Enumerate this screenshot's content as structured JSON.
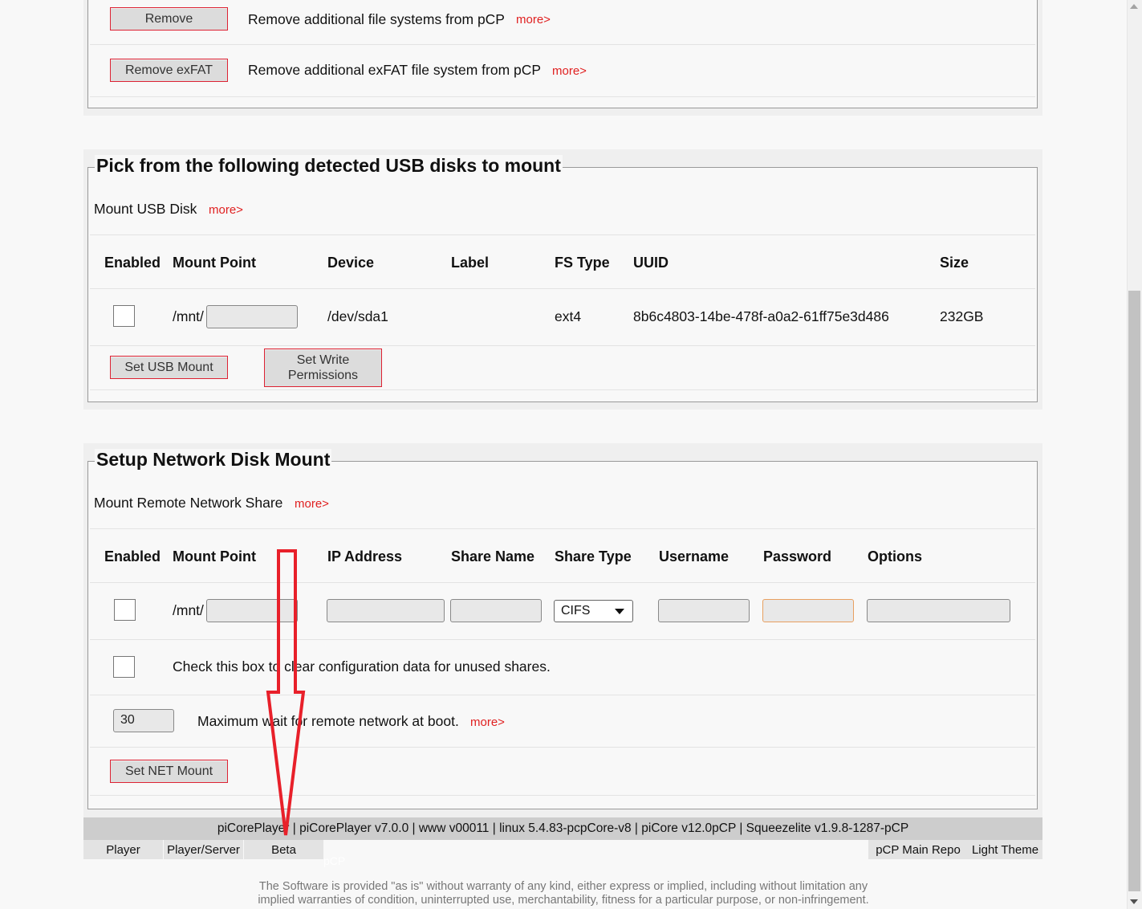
{
  "remove_section": {
    "rows": [
      {
        "button": "Remove",
        "text": "Remove additional file systems from pCP",
        "more": "more>"
      },
      {
        "button": "Remove exFAT",
        "text": "Remove additional exFAT file system from pCP",
        "more": "more>"
      }
    ]
  },
  "usb_section": {
    "legend": "Pick from the following detected USB disks to mount",
    "subtitle": "Mount USB Disk",
    "more": "more>",
    "headers": [
      "Enabled",
      "Mount Point",
      "Device",
      "Label",
      "FS Type",
      "UUID",
      "Size"
    ],
    "row": {
      "mount_prefix": "/mnt/",
      "mount_value": "",
      "device": "/dev/sda1",
      "label": "",
      "fs_type": "ext4",
      "uuid": "8b6c4803-14be-478f-a0a2-61ff75e3d486",
      "size": "232GB"
    },
    "set_button": "Set USB Mount",
    "perm_button": "Set Write Permissions"
  },
  "net_section": {
    "legend": "Setup Network Disk Mount",
    "subtitle": "Mount Remote Network Share",
    "more": "more>",
    "headers": [
      "Enabled",
      "Mount Point",
      "IP Address",
      "Share Name",
      "Share Type",
      "Username",
      "Password",
      "Options"
    ],
    "row": {
      "mount_prefix": "/mnt/",
      "share_type": "CIFS"
    },
    "clear_text": "Check this box to clear configuration data for unused shares.",
    "wait_value": "30",
    "wait_text": "Maximum wait for remote network at boot.",
    "wait_more": "more>",
    "set_button": "Set NET Mount"
  },
  "footer": {
    "version": "piCorePlayer | piCorePlayer v7.0.0 | www v00011 | linux 5.4.83-pcpCore-v8 | piCore v12.0pCP | Squeezelite v1.9.8-1287-pCP",
    "tabs_left": [
      "Player",
      "Player/Server",
      "Beta"
    ],
    "tabs_right": [
      "pCP Main Repo",
      "Light Theme"
    ],
    "ghost": "pCP",
    "disclaimer_1": "The Software is provided \"as is\" without warranty of any kind, either express or implied, including without limitation any",
    "disclaimer_2": "implied warranties of condition, uninterrupted use, merchantability, fitness for a particular purpose, or non-infringement."
  },
  "colors": {
    "accent_red": "#e02020",
    "annotation_arrow": "#e8202a"
  }
}
